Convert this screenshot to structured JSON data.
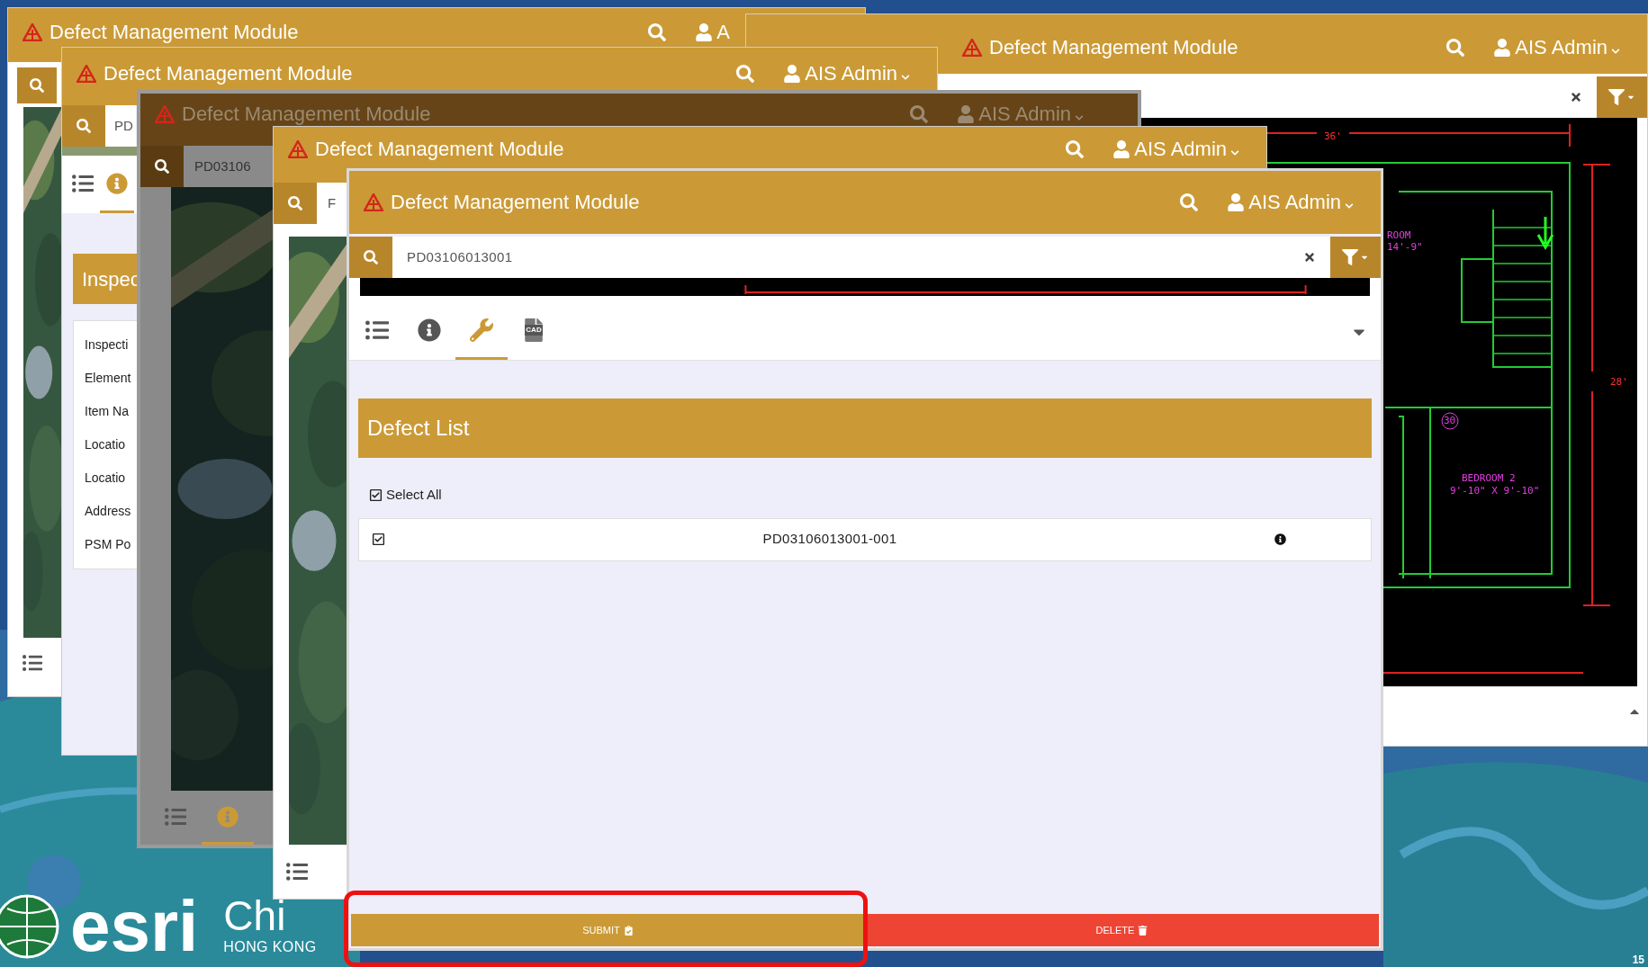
{
  "slide": {
    "brand": "esri",
    "brand_suffix": "Chi",
    "region": "HONG KONG",
    "page_number": "15"
  },
  "back_window": {
    "title": "Defect Management Module",
    "user": "A"
  },
  "cad_window": {
    "title": "Defect Management Module",
    "user": "AIS Admin",
    "drawing_labels": [
      "36'",
      "ROOM",
      "14'-9\"",
      "28'",
      "30",
      "BEDROOM 2",
      "9'-10\" X 9'-10\""
    ]
  },
  "inspection_window": {
    "title": "Defect Management Module",
    "user": "AIS Admin",
    "search_value": "PD",
    "tabs": [
      {
        "kind": "list",
        "selected": false
      },
      {
        "kind": "info",
        "selected": true
      }
    ],
    "section_title": "Inspec",
    "fields": [
      "Inspecti",
      "Element",
      "Item Na",
      "Locatio",
      "Locatio",
      "Address",
      "PSM Po"
    ]
  },
  "dimmed_window": {
    "title": "Defect Management Module",
    "user": "AIS Admin",
    "search_value": "PD03106",
    "tabs": [
      {
        "kind": "list",
        "selected": false
      },
      {
        "kind": "info",
        "selected": true
      }
    ]
  },
  "map_window": {
    "title": "Defect Management Module",
    "user": "AIS Admin",
    "search_value": "F"
  },
  "defect_window": {
    "title": "Defect Management Module",
    "user": "AIS Admin",
    "search_value": "PD03106013001",
    "tabs": [
      {
        "kind": "list",
        "selected": false
      },
      {
        "kind": "info",
        "selected": false
      },
      {
        "kind": "tool",
        "selected": true
      },
      {
        "kind": "cad",
        "label": "CAD",
        "selected": false
      }
    ],
    "section_title": "Defect List",
    "select_all": {
      "label": "Select All",
      "checked": true
    },
    "defects": [
      {
        "id": "PD03106013001-001",
        "checked": true
      }
    ],
    "buttons": [
      {
        "kind": "submit",
        "label": "SUBMIT"
      },
      {
        "kind": "delete",
        "label": "DELETE"
      }
    ]
  }
}
